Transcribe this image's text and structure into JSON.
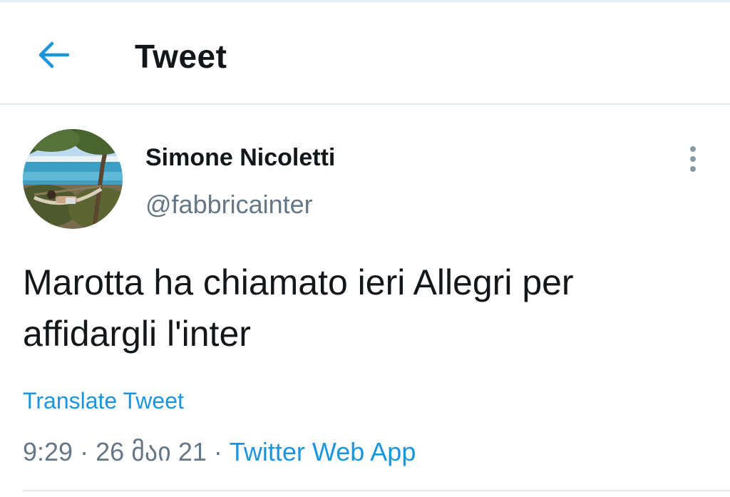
{
  "header": {
    "back_icon": "arrow-left-icon",
    "title": "Tweet"
  },
  "tweet": {
    "author": {
      "display_name": "Simone Nicoletti",
      "handle": "@fabbricainter",
      "avatar": "avatar-photo-beach-hammock"
    },
    "more_icon": "more-vertical-icon",
    "text": "Marotta ha chiamato ieri Allegri per\naffidargli l'inter",
    "translate_label": "Translate Tweet",
    "time": "9:29",
    "separator": " · ",
    "date": "26 მაი 21",
    "source": "Twitter Web App"
  },
  "colors": {
    "accent": "#1b95e0",
    "text_primary": "#14171a",
    "text_secondary": "#657786",
    "divider": "#e1e8ed"
  }
}
